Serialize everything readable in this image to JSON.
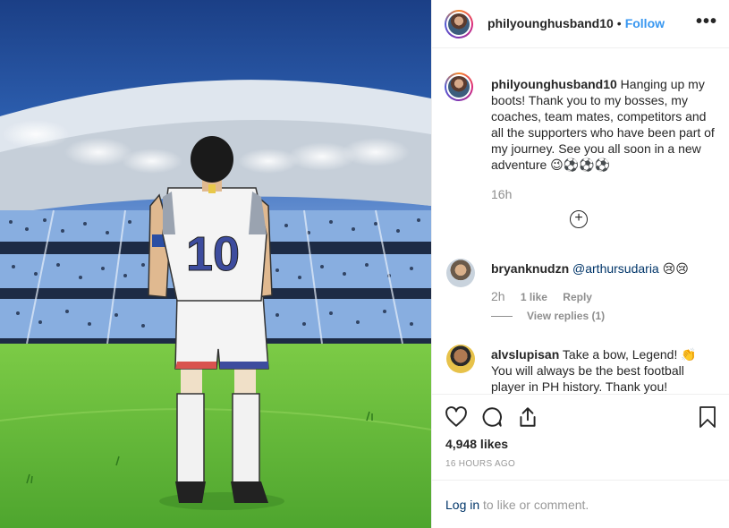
{
  "post": {
    "username": "philyounghusband10",
    "separator": "•",
    "follow_label": "Follow",
    "more_icon": "more-options-icon",
    "more_label": "•••",
    "caption_text": "Hanging up my boots! Thank you to my bosses, my coaches, team mates, competitors and all the supporters who have been part of my journey. See you all soon in a new adventure 😉⚽⚽⚽",
    "caption_age": "16h",
    "load_more_label": "+",
    "jersey_number": "10"
  },
  "comments": [
    {
      "username": "bryanknudzn",
      "mention": "@arthursudaria",
      "text": "😢😢",
      "age": "2h",
      "likes": "1 like",
      "reply_label": "Reply",
      "view_replies_label": "View replies (1)"
    },
    {
      "username": "alvslupisan",
      "text": "Take a bow, Legend! 👏 You will always be the best football player in PH history. Thank you!"
    }
  ],
  "actions": {
    "likes_count": "4,948 likes",
    "timestamp": "16 HOURS AGO"
  },
  "login": {
    "link_label": "Log in",
    "rest_text": " to like or comment."
  },
  "colors": {
    "link_blue": "#3897f0",
    "dark_link": "#003569",
    "muted": "#8e8e8e",
    "grass": "#5fb83a",
    "sky": "#2a5aa8"
  }
}
